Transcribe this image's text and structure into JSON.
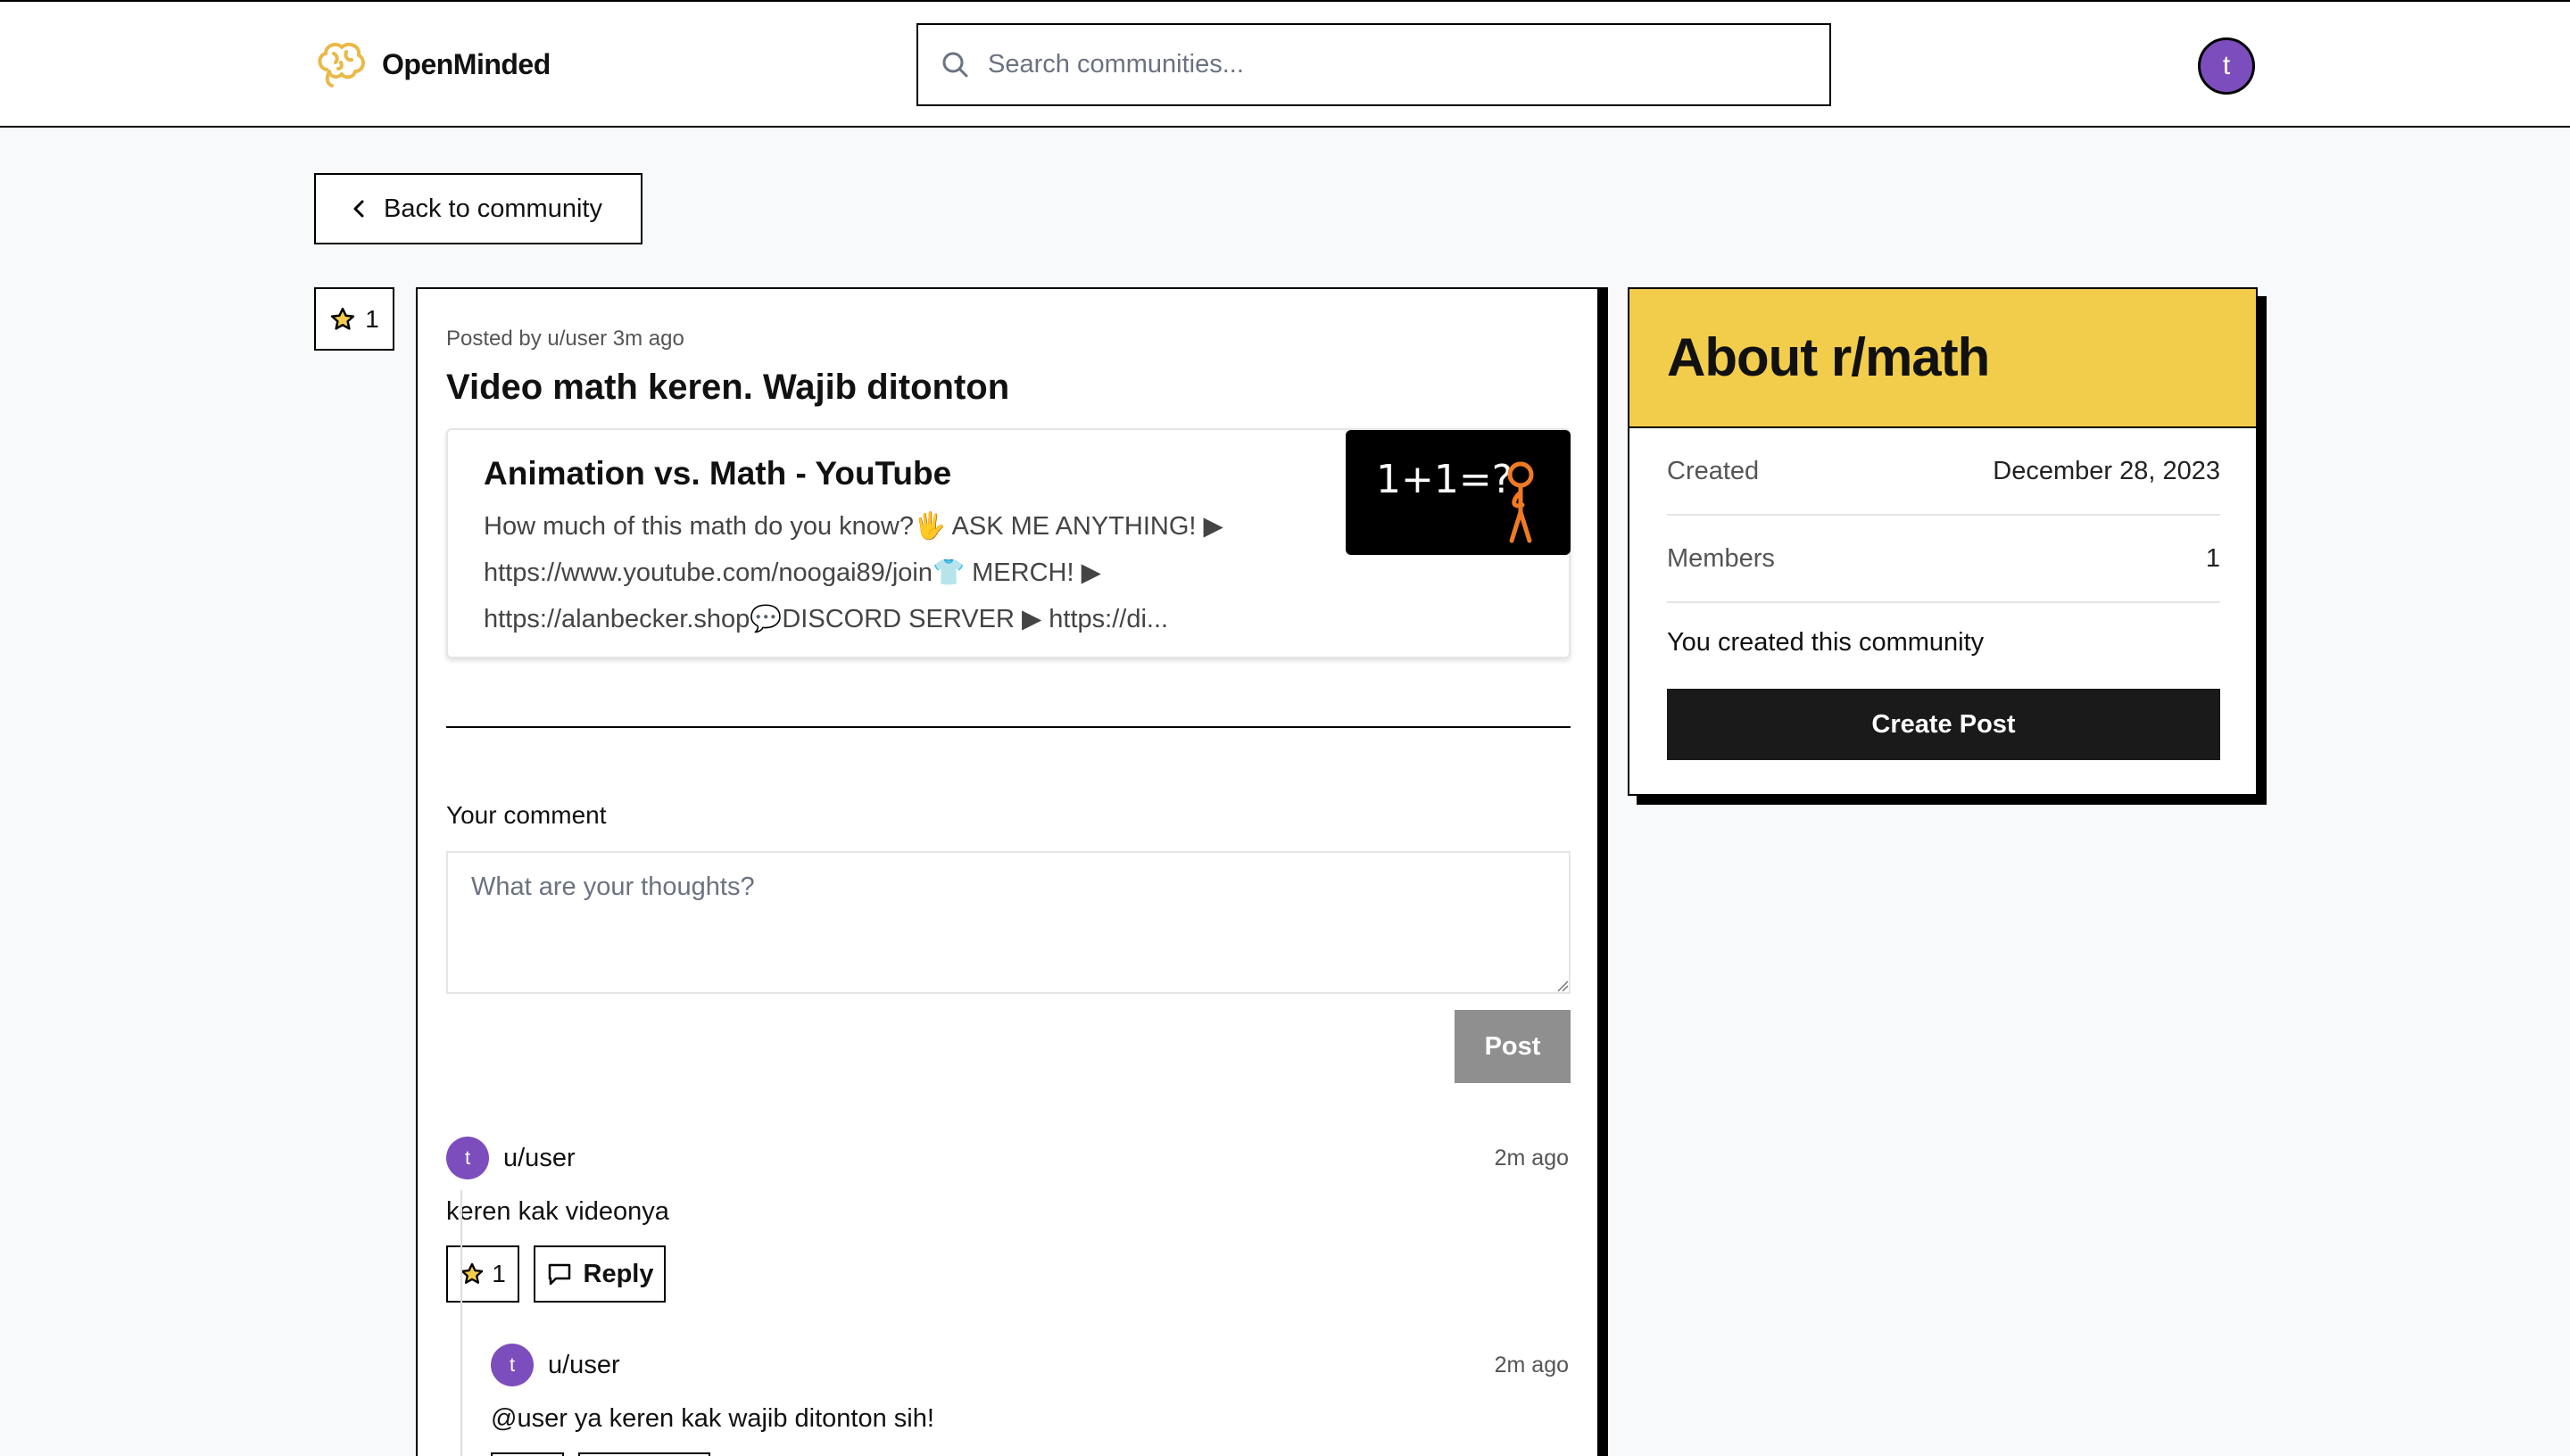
{
  "navbar": {
    "brand": "OpenMinded",
    "search_placeholder": "Search communities...",
    "avatar_initial": "t"
  },
  "back_button": {
    "label": "Back to community"
  },
  "post": {
    "vote_count": "1",
    "meta": "Posted by u/user 3m ago",
    "title": "Video math keren. Wajib ditonton",
    "link_preview": {
      "title": "Animation vs. Math - YouTube",
      "description_line1": "How much of this math do you know?🖐 ASK ME ANYTHING! ▶",
      "description_line2": "https://www.youtube.com/noogai89/join👕 MERCH! ▶",
      "description_line3": "https://alanbecker.shop💬DISCORD SERVER ▶ https://di...",
      "thumbnail_text": "1+1=?"
    }
  },
  "comment_form": {
    "label": "Your comment",
    "placeholder": "What are your thoughts?",
    "submit_label": "Post"
  },
  "comments": [
    {
      "avatar_initial": "t",
      "user": "u/user",
      "time": "2m ago",
      "text": "keren kak videonya",
      "vote_count": "1",
      "reply_label": "Reply"
    },
    {
      "avatar_initial": "t",
      "user": "u/user",
      "time": "2m ago",
      "text": "@user ya keren kak wajib ditonton sih!"
    }
  ],
  "sidebar": {
    "title": "About r/math",
    "rows": [
      {
        "key": "Created",
        "value": "December 28, 2023"
      },
      {
        "key": "Members",
        "value": "1"
      }
    ],
    "note": "You created this community",
    "create_label": "Create Post"
  },
  "colors": {
    "accent_yellow": "#f2cd4b",
    "avatar_purple": "#7c4dbc",
    "brand_logo": "#e9b949"
  },
  "icons": [
    "brain-logo-icon",
    "search-icon",
    "chevron-left-icon",
    "star-icon",
    "comment-icon"
  ]
}
